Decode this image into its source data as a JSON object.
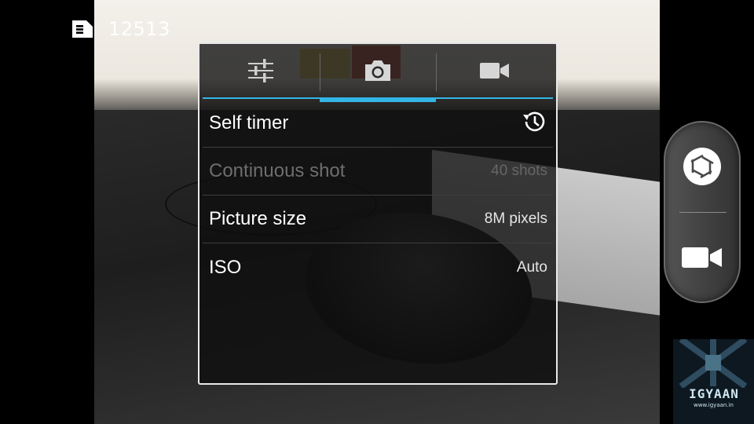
{
  "status": {
    "storage_icon": "sd-card-icon",
    "remaining_count": "12513"
  },
  "tabs": [
    {
      "icon": "sliders-icon",
      "active": false
    },
    {
      "icon": "camera-icon",
      "active": true
    },
    {
      "icon": "video-camera-icon",
      "active": false
    }
  ],
  "settings": [
    {
      "label": "Self timer",
      "value_icon": "timer-history-icon",
      "enabled": true
    },
    {
      "label": "Continuous shot",
      "value": "40 shots",
      "enabled": false
    },
    {
      "label": "Picture size",
      "value": "8M pixels",
      "enabled": true
    },
    {
      "label": "ISO",
      "value": "Auto",
      "enabled": true
    }
  ],
  "controls": {
    "shutter_icon": "shutter-icon",
    "video_icon": "video-camera-icon"
  },
  "watermark": {
    "title": "IGYAAN",
    "url": "www.igyaan.in"
  },
  "colors": {
    "accent": "#33b5e5",
    "panel_border": "#e9e9e9",
    "disabled_text": "#6e6e6e"
  }
}
